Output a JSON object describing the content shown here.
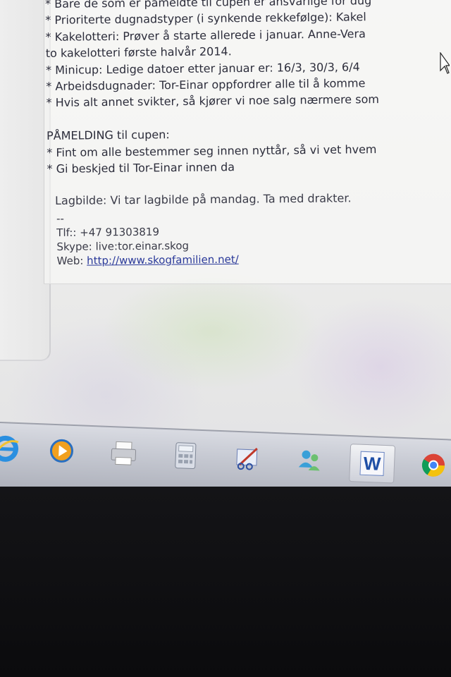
{
  "email": {
    "lines": [
      "* Bare de som er påmeldte til cupen er ansvarlige for dug",
      "* Prioriterte dugnadstyper (i synkende rekkefølge): Kakel",
      "* Kakelotteri: Prøver å starte allerede i januar. Anne-Vera",
      "to kakelotteri første halvår 2014.",
      "* Minicup: Ledige datoer etter januar er: 16/3, 30/3, 6/4",
      "* Arbeidsdugnader: Tor-Einar oppfordrer alle til å komme",
      "* Hvis alt annet svikter, så kjører vi noe salg nærmere som"
    ],
    "registration_heading": "PÅMELDING til cupen:",
    "registration_lines": [
      "* Fint om alle bestemmer seg innen nyttår, så vi vet hvem",
      "* Gi beskjed til Tor-Einar innen da"
    ],
    "team_photo": "Lagbilde: Vi tar lagbilde på mandag. Ta med drakter.",
    "signature": {
      "separator": "--",
      "phone": "Tlf:: +47 91303819",
      "skype": "Skype: live:tor.einar.skog",
      "web_label": "Web: ",
      "web_link": "http://www.skogfamilien.net/"
    }
  },
  "taskbar": {
    "items": [
      {
        "name": "internet-explorer",
        "icon": "ie-icon"
      },
      {
        "name": "media-player",
        "icon": "media-player-icon"
      },
      {
        "name": "printer",
        "icon": "printer-icon"
      },
      {
        "name": "calculator",
        "icon": "calculator-icon"
      },
      {
        "name": "snipping-tool",
        "icon": "snipping-tool-icon"
      },
      {
        "name": "people",
        "icon": "people-icon"
      },
      {
        "name": "word",
        "icon": "word-icon",
        "glyph": "W"
      },
      {
        "name": "chrome",
        "icon": "chrome-icon"
      }
    ]
  },
  "colors": {
    "text": "#2c2d3b",
    "link": "#2b3a9a",
    "taskbar": "#c6c9d2"
  }
}
